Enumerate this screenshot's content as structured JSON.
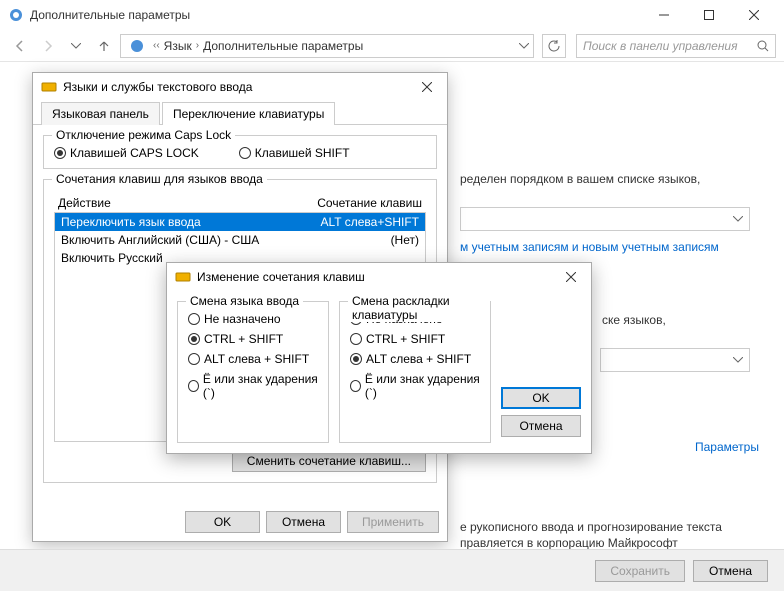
{
  "window": {
    "title": "Дополнительные параметры"
  },
  "breadcrumb": {
    "item1": "Язык",
    "item2": "Дополнительные параметры"
  },
  "search": {
    "placeholder": "Поиск в панели управления"
  },
  "background": {
    "text1": "ределен порядком в вашем списке языков,",
    "link1": "м учетным записям и новым учетным записям",
    "text2": "ске языков,",
    "params_link": "Параметры",
    "text3": "е рукописного ввода и прогнозирование текста",
    "text4": "правляется в корпорацию Майкрософт"
  },
  "dialog1": {
    "title": "Языки и службы текстового ввода",
    "tab1": "Языковая панель",
    "tab2": "Переключение клавиатуры",
    "group1": {
      "title": "Отключение режима Caps Lock",
      "opt1": "Клавишей CAPS LOCK",
      "opt2": "Клавишей SHIFT"
    },
    "group2": {
      "title": "Сочетания клавиш для языков ввода",
      "col1": "Действие",
      "col2": "Сочетание клавиш",
      "rows": [
        {
          "action": "Переключить язык ввода",
          "keys": "ALT слева+SHIFT"
        },
        {
          "action": "Включить Английский (США) - США",
          "keys": "(Нет)"
        },
        {
          "action": "Включить Русский",
          "keys": ""
        }
      ],
      "change_btn": "Сменить сочетание клавиш..."
    },
    "buttons": {
      "ok": "OK",
      "cancel": "Отмена",
      "apply": "Применить"
    }
  },
  "dialog2": {
    "title": "Изменение сочетания клавиш",
    "col1_title": "Смена языка ввода",
    "col2_title": "Смена раскладки клавиатуры",
    "options": {
      "none": "Не назначено",
      "ctrl_shift": "CTRL + SHIFT",
      "alt_shift": "ALT слева + SHIFT",
      "yo": "Ё или знак ударения (`)"
    },
    "ok": "OK",
    "cancel": "Отмена"
  },
  "bottom": {
    "save": "Сохранить",
    "cancel": "Отмена"
  }
}
